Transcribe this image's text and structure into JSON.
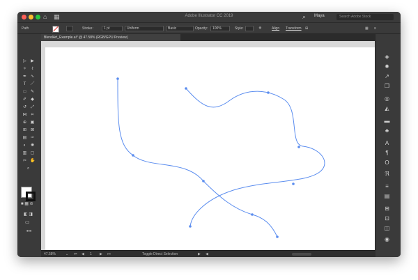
{
  "window": {
    "app_title": "Adobe Illustrator CC 2019",
    "user": "Maya",
    "search_placeholder": "Search Adobe Stock"
  },
  "control_bar": {
    "selection_label": "Path",
    "stroke_label": "Stroke:",
    "stroke_weight": "1 pt",
    "profile_label": "Uniform",
    "brush_label": "Basic",
    "opacity_label": "Opacity:",
    "opacity_value": "100%",
    "style_label": "Style:",
    "align_label": "Align",
    "transform_label": "Transform"
  },
  "document": {
    "tab_title": "BlendArt_Example.ai* @ 47.58% (RGB/GPU Preview)",
    "background_color": "#ffffff",
    "stroke_color": "#5b8def"
  },
  "status_bar": {
    "zoom": "47.58%",
    "artboard_number": "1",
    "current_tool": "Toggle Direct Selection"
  },
  "icons": {
    "tools": [
      "selection-icon",
      "direct-selection-icon",
      "magic-wand-icon",
      "lasso-icon",
      "pen-icon",
      "curvature-icon",
      "type-icon",
      "line-icon",
      "rectangle-icon",
      "paintbrush-icon",
      "shaper-icon",
      "eraser-icon",
      "rotate-icon",
      "scale-icon",
      "width-icon",
      "free-transform-icon",
      "shape-builder-icon",
      "live-paint-icon",
      "perspective-icon",
      "mesh-icon",
      "gradient-icon",
      "eyedropper-icon",
      "blend-icon",
      "symbol-sprayer-icon",
      "column-graph-icon",
      "artboard-icon",
      "slice-icon",
      "hand-icon",
      "zoom-icon"
    ],
    "right_panels": [
      "libraries-icon",
      "properties-icon",
      "export-icon",
      "layers-icon",
      "appearance-icon",
      "graphic-styles-icon",
      "image-trace-icon",
      "symbols-icon",
      "character-icon",
      "paragraph-icon",
      "opentype-icon",
      "glyphs-icon",
      "stroke-icon",
      "gradient-icon",
      "align-icon",
      "pathfinder-icon",
      "transparency-icon",
      "color-guide-icon"
    ]
  }
}
